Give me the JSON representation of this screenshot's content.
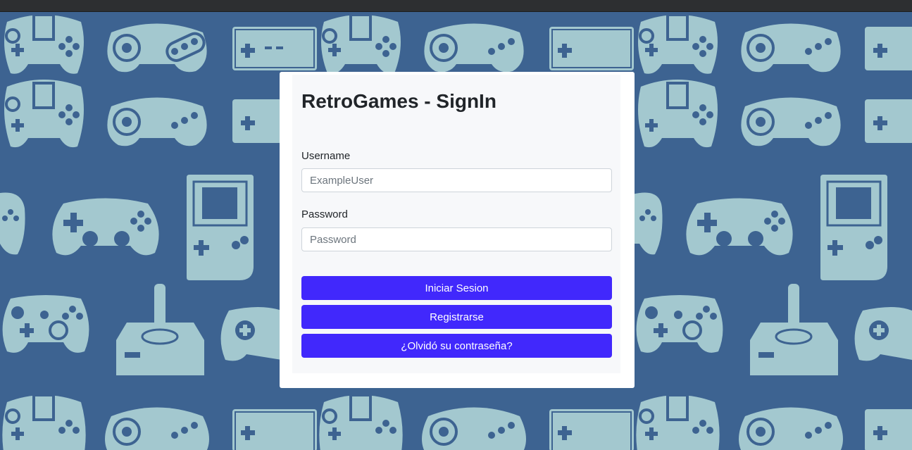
{
  "colors": {
    "background": "#3d6391",
    "pattern": "#a3c8cf",
    "button": "#4128fc"
  },
  "icons": [
    "gamepad-icon",
    "sega-controller-icon",
    "nes-controller-icon",
    "gameboy-icon",
    "joystick-icon"
  ],
  "login": {
    "title": "RetroGames - SignIn",
    "username_label": "Username",
    "username_placeholder": "ExampleUser",
    "password_label": "Password",
    "password_placeholder": "Password",
    "signin_button": "Iniciar Sesion",
    "register_button": "Registrarse",
    "forgot_button": "¿Olvidó su contraseña?"
  }
}
